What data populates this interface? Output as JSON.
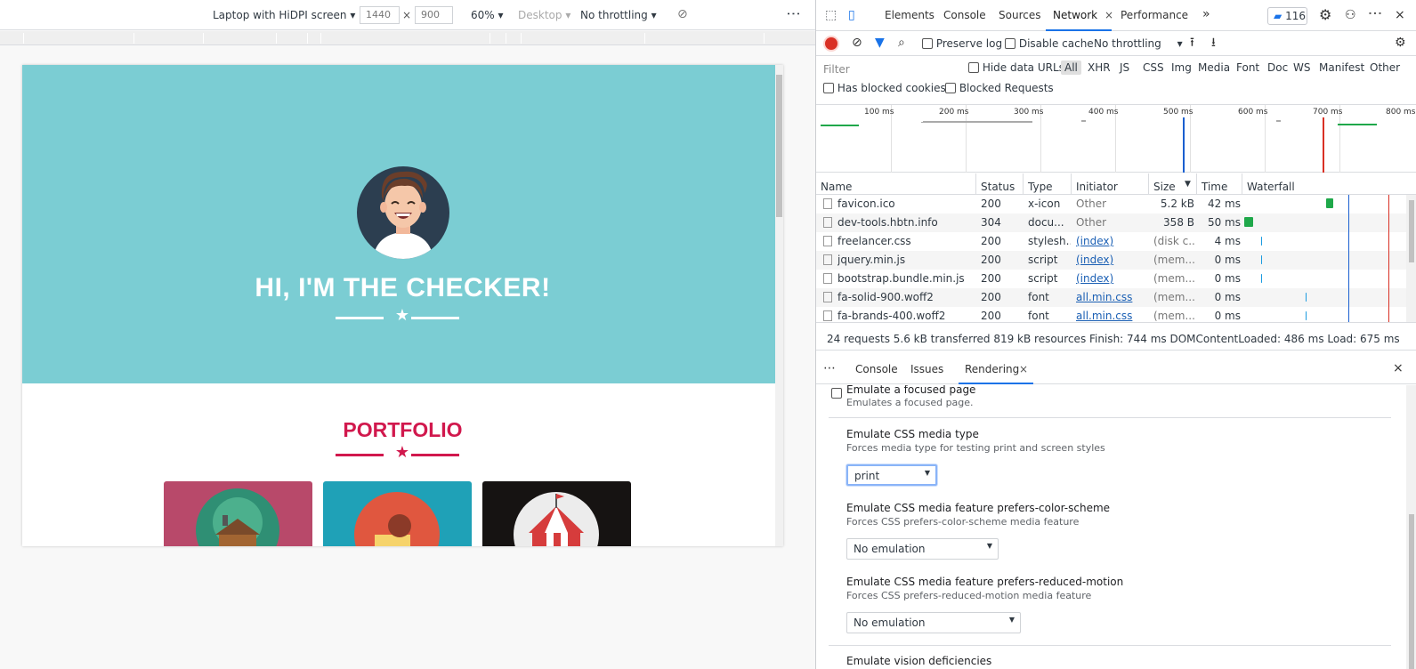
{
  "device_toolbar": {
    "device": "Laptop with HiDPI screen",
    "width": "1440",
    "x": "×",
    "height": "900",
    "zoom": "60%",
    "mode": "Desktop",
    "throttle": "No throttling",
    "more": "⋮"
  },
  "page": {
    "hero_title": "HI, I'M THE CHECKER!",
    "portfolio_title": "PORTFOLIO",
    "colors": {
      "masthead": "#7bcdd3",
      "accent": "#d1184d",
      "card1": "#b8496a",
      "card2": "#1fa1b7",
      "card3": "#161312"
    }
  },
  "devtools": {
    "tabs": [
      "Elements",
      "Console",
      "Sources",
      "Network",
      "Performance"
    ],
    "active_tab": "Network",
    "close_glyph": "×",
    "more_tabs": "»",
    "issues_count": "116",
    "network_toolbar": {
      "preserve_log": "Preserve log",
      "disable_cache": "Disable cache",
      "throttle": "No throttling"
    },
    "filter": {
      "placeholder": "Filter",
      "hide_data_urls": "Hide data URLs",
      "types": [
        "All",
        "XHR",
        "JS",
        "CSS",
        "Img",
        "Media",
        "Font",
        "Doc",
        "WS",
        "Manifest",
        "Other"
      ],
      "has_blocked_cookies": "Has blocked cookies",
      "blocked_requests": "Blocked Requests"
    },
    "overview_ticks": [
      "100 ms",
      "200 ms",
      "300 ms",
      "400 ms",
      "500 ms",
      "600 ms",
      "700 ms",
      "800 ms"
    ],
    "table": {
      "headers": [
        "Name",
        "Status",
        "Type",
        "Initiator",
        "Size",
        "Time",
        "Waterfall"
      ],
      "rows": [
        {
          "name": "favicon.ico",
          "status": "200",
          "type": "x-icon",
          "initiator": "Other",
          "size": "5.2 kB",
          "time": "42 ms"
        },
        {
          "name": "dev-tools.hbtn.info",
          "status": "304",
          "type": "docu...",
          "initiator": "Other",
          "size": "358 B",
          "time": "50 ms"
        },
        {
          "name": "freelancer.css",
          "status": "200",
          "type": "stylesh...",
          "initiator": "(index)",
          "size": "(disk c...",
          "time": "4 ms"
        },
        {
          "name": "jquery.min.js",
          "status": "200",
          "type": "script",
          "initiator": "(index)",
          "size": "(mem...",
          "time": "0 ms"
        },
        {
          "name": "bootstrap.bundle.min.js",
          "status": "200",
          "type": "script",
          "initiator": "(index)",
          "size": "(mem...",
          "time": "0 ms"
        },
        {
          "name": "fa-solid-900.woff2",
          "status": "200",
          "type": "font",
          "initiator": "all.min.css",
          "size": "(mem...",
          "time": "0 ms"
        },
        {
          "name": "fa-brands-400.woff2",
          "status": "200",
          "type": "font",
          "initiator": "all.min.css",
          "size": "(mem...",
          "time": "0 ms"
        }
      ]
    },
    "summary": "24 requests  5.6 kB transferred  819 kB resources  Finish: 744 ms  DOMContentLoaded: 486 ms  Load: 675 ms",
    "drawer_tabs": [
      "Console",
      "Issues",
      "Rendering"
    ],
    "drawer_active": "Rendering",
    "rendering": {
      "focused_title": "Emulate a focused page",
      "focused_sub": "Emulates a focused page.",
      "media_title": "Emulate CSS media type",
      "media_sub": "Forces media type for testing print and screen styles",
      "media_value": "print",
      "scheme_title": "Emulate CSS media feature prefers-color-scheme",
      "scheme_sub": "Forces CSS prefers-color-scheme media feature",
      "scheme_value": "No emulation",
      "motion_title": "Emulate CSS media feature prefers-reduced-motion",
      "motion_sub": "Forces CSS prefers-reduced-motion media feature",
      "motion_value": "No emulation",
      "vision_title": "Emulate vision deficiencies"
    }
  }
}
